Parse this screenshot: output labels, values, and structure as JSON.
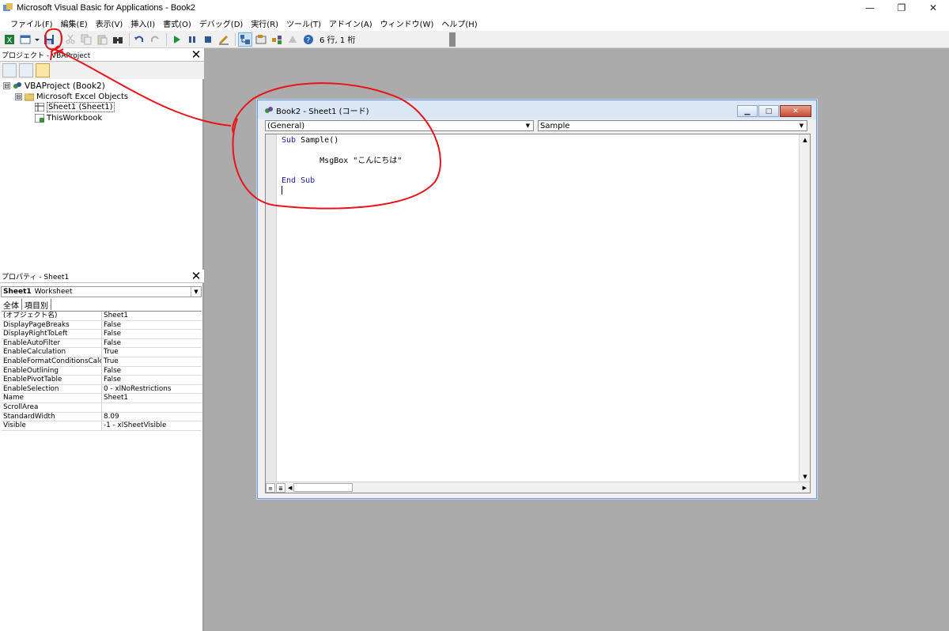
{
  "window": {
    "title": "Microsoft Visual Basic for Applications - Book2",
    "minimize": "—",
    "restore": "❐",
    "close": "✕"
  },
  "menu": [
    "ファイル(F)",
    "編集(E)",
    "表示(V)",
    "挿入(I)",
    "書式(O)",
    "デバッグ(D)",
    "実行(R)",
    "ツール(T)",
    "アドイン(A)",
    "ウィンドウ(W)",
    "ヘルプ(H)"
  ],
  "toolbar": {
    "position": "6 行, 1 桁"
  },
  "project": {
    "title": "プロジェクト - VBAProject",
    "close": "✕",
    "tree": [
      {
        "label": "VBAProject (Book2)",
        "expander": "⊟"
      },
      {
        "label": "Microsoft Excel Objects",
        "expander": "⊟"
      },
      {
        "label": "Sheet1 (Sheet1)"
      },
      {
        "label": "ThisWorkbook"
      }
    ]
  },
  "properties": {
    "title": "プロパティ - Sheet1",
    "close": "✕",
    "object": "Sheet1",
    "object_type": "Worksheet",
    "tabs": [
      "全体",
      "項目別"
    ],
    "rows": [
      {
        "k": "(オブジェクト名)",
        "v": "Sheet1"
      },
      {
        "k": "DisplayPageBreaks",
        "v": "False"
      },
      {
        "k": "DisplayRightToLeft",
        "v": "False"
      },
      {
        "k": "EnableAutoFilter",
        "v": "False"
      },
      {
        "k": "EnableCalculation",
        "v": "True"
      },
      {
        "k": "EnableFormatConditionsCalcul",
        "v": "True"
      },
      {
        "k": "EnableOutlining",
        "v": "False"
      },
      {
        "k": "EnablePivotTable",
        "v": "False"
      },
      {
        "k": "EnableSelection",
        "v": "0 - xlNoRestrictions"
      },
      {
        "k": "Name",
        "v": "Sheet1"
      },
      {
        "k": "ScrollArea",
        "v": ""
      },
      {
        "k": "StandardWidth",
        "v": "8.09"
      },
      {
        "k": "Visible",
        "v": "-1 - xlSheetVisible"
      }
    ]
  },
  "codewin": {
    "title": "Book2 - Sheet1 (コード)",
    "object_combo": "(General)",
    "proc_combo": "Sample",
    "code": {
      "line1_kw": "Sub",
      "line1_rest": " Sample()",
      "line3": "        MsgBox \"こんにちは\"",
      "line5_kw": "End Sub"
    }
  }
}
